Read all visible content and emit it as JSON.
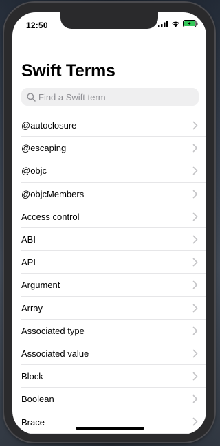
{
  "status_bar": {
    "time": "12:50",
    "icons": [
      "signal-icon",
      "wifi-icon",
      "battery-charging-icon"
    ]
  },
  "header": {
    "title": "Swift Terms"
  },
  "search": {
    "placeholder": "Find a Swift term",
    "value": "",
    "icon": "search-icon"
  },
  "terms": [
    {
      "label": "@autoclosure"
    },
    {
      "label": "@escaping"
    },
    {
      "label": "@objc"
    },
    {
      "label": "@objcMembers"
    },
    {
      "label": "Access control"
    },
    {
      "label": "ABI"
    },
    {
      "label": "API"
    },
    {
      "label": "Argument"
    },
    {
      "label": "Array"
    },
    {
      "label": "Associated type"
    },
    {
      "label": "Associated value"
    },
    {
      "label": "Block"
    },
    {
      "label": "Boolean"
    },
    {
      "label": "Brace"
    }
  ],
  "colors": {
    "accent": "#000000",
    "placeholder": "#8e8e93",
    "chevron": "#c4c4c7",
    "battery_charge": "#34c759"
  }
}
